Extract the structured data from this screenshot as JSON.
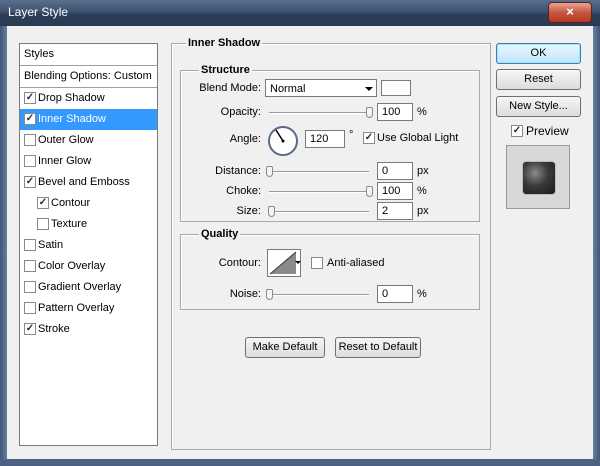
{
  "window": {
    "title": "Layer Style",
    "close_glyph": "×"
  },
  "styles_panel": {
    "header": "Styles",
    "blending": "Blending Options: Custom",
    "items": [
      {
        "label": "Drop Shadow",
        "checked": true,
        "selected": false,
        "sub": false
      },
      {
        "label": "Inner Shadow",
        "checked": true,
        "selected": true,
        "sub": false
      },
      {
        "label": "Outer Glow",
        "checked": false,
        "selected": false,
        "sub": false
      },
      {
        "label": "Inner Glow",
        "checked": false,
        "selected": false,
        "sub": false
      },
      {
        "label": "Bevel and Emboss",
        "checked": true,
        "selected": false,
        "sub": false
      },
      {
        "label": "Contour",
        "checked": true,
        "selected": false,
        "sub": true
      },
      {
        "label": "Texture",
        "checked": false,
        "selected": false,
        "sub": true
      },
      {
        "label": "Satin",
        "checked": false,
        "selected": false,
        "sub": false
      },
      {
        "label": "Color Overlay",
        "checked": false,
        "selected": false,
        "sub": false
      },
      {
        "label": "Gradient Overlay",
        "checked": false,
        "selected": false,
        "sub": false
      },
      {
        "label": "Pattern Overlay",
        "checked": false,
        "selected": false,
        "sub": false
      },
      {
        "label": "Stroke",
        "checked": true,
        "selected": false,
        "sub": false
      }
    ]
  },
  "inner_shadow": {
    "title": "Inner Shadow",
    "structure": {
      "title": "Structure",
      "blend_mode_label": "Blend Mode:",
      "blend_mode_value": "Normal",
      "opacity_label": "Opacity:",
      "opacity_value": "100",
      "opacity_level": 1.0,
      "percent": "%",
      "angle_label": "Angle:",
      "angle_value": "120",
      "degree": "°",
      "global_light_label": "Use Global Light",
      "global_light_checked": true,
      "distance_label": "Distance:",
      "distance_value": "0",
      "distance_level": 0.0,
      "px": "px",
      "choke_label": "Choke:",
      "choke_value": "100",
      "choke_level": 1.0,
      "size_label": "Size:",
      "size_value": "2",
      "size_level": 0.02
    },
    "quality": {
      "title": "Quality",
      "contour_label": "Contour:",
      "anti_aliased_label": "Anti-aliased",
      "anti_aliased_checked": false,
      "noise_label": "Noise:",
      "noise_value": "0",
      "noise_level": 0.0,
      "percent": "%"
    },
    "make_default": "Make Default",
    "reset_default": "Reset to Default"
  },
  "buttons": {
    "ok": "OK",
    "reset": "Reset",
    "new_style": "New Style...",
    "preview_label": "Preview",
    "preview_checked": true
  },
  "check_glyph": "✓",
  "colors": {
    "selection": "#3399ff",
    "title_bar": "#3d5170",
    "close": "#c7553f"
  }
}
